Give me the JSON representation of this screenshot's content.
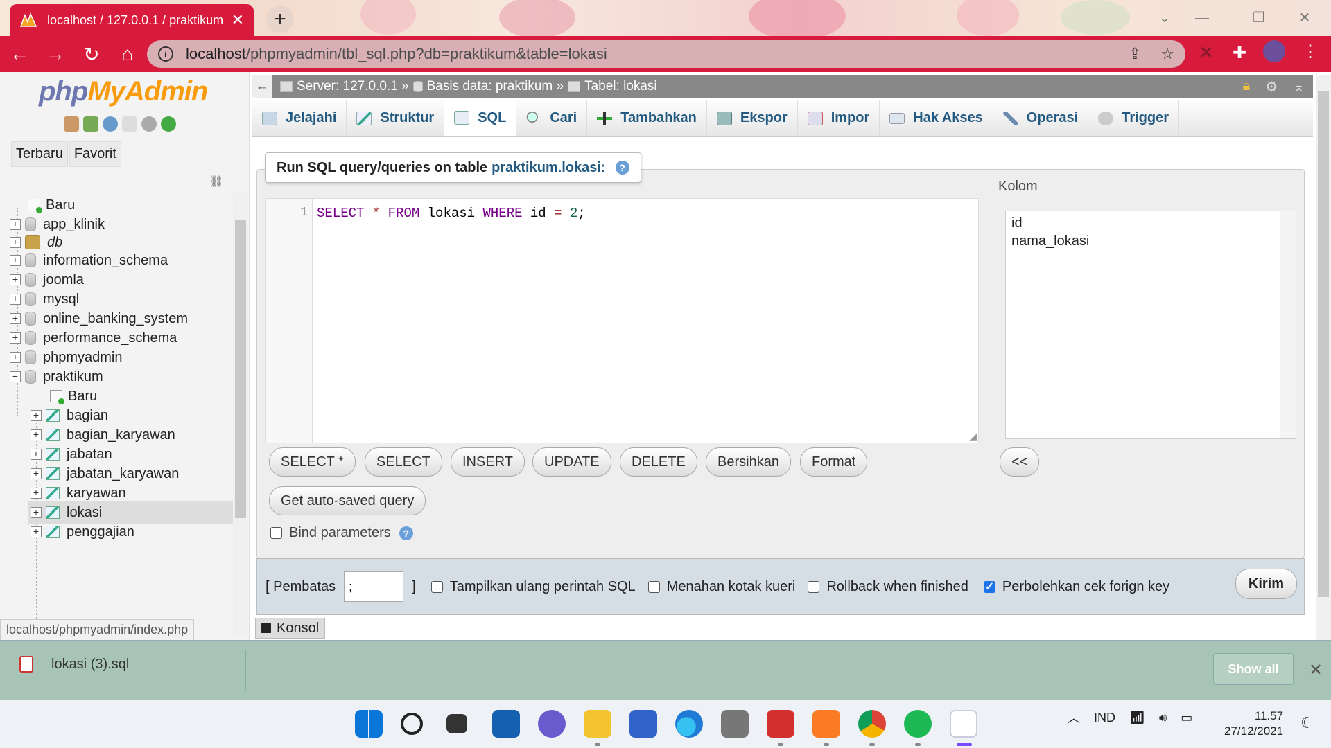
{
  "browser": {
    "tab_title": "localhost / 127.0.0.1 / praktikum",
    "url_host": "localhost",
    "url_path": "/phpmyadmin/tbl_sql.php?db=praktikum&table=lokasi",
    "status_link": "localhost/phpmyadmin/index.php"
  },
  "nav": {
    "logo_php": "php",
    "logo_myadmin": "MyAdmin",
    "tab_recent": "Terbaru",
    "tab_favorite": "Favorit",
    "tree": [
      {
        "label": "Baru"
      },
      {
        "label": "app_klinik"
      },
      {
        "label": "db"
      },
      {
        "label": "information_schema"
      },
      {
        "label": "joomla"
      },
      {
        "label": "mysql"
      },
      {
        "label": "online_banking_system"
      },
      {
        "label": "performance_schema"
      },
      {
        "label": "phpmyadmin"
      },
      {
        "label": "praktikum"
      },
      {
        "label": "Baru"
      },
      {
        "label": "bagian"
      },
      {
        "label": "bagian_karyawan"
      },
      {
        "label": "jabatan"
      },
      {
        "label": "jabatan_karyawan"
      },
      {
        "label": "karyawan"
      },
      {
        "label": "lokasi"
      },
      {
        "label": "penggajian"
      }
    ]
  },
  "breadcrumb": {
    "server": "Server: 127.0.0.1 »",
    "database": "Basis data: praktikum »",
    "table": "Tabel: lokasi"
  },
  "tabs": [
    "Jelajahi",
    "Struktur",
    "SQL",
    "Cari",
    "Tambahkan",
    "Ekspor",
    "Impor",
    "Hak Akses",
    "Operasi",
    "Trigger"
  ],
  "sql": {
    "legend_prefix": "Run SQL query/queries on table",
    "legend_table": "praktikum.lokasi:",
    "line_number": "1",
    "code": {
      "k1": "SELECT",
      "star": "*",
      "k2": "FROM",
      "table": "lokasi",
      "k3": "WHERE",
      "col": "id",
      "eq": "=",
      "val": "2",
      "semi": ";"
    },
    "buttons": [
      "SELECT *",
      "SELECT",
      "INSERT",
      "UPDATE",
      "DELETE",
      "Bersihkan",
      "Format"
    ],
    "autosaved": "Get auto-saved query",
    "bind_params": "Bind parameters",
    "kolom_label": "Kolom",
    "columns": [
      "id",
      "nama_lokasi"
    ],
    "insert_btn": "<<"
  },
  "footer": {
    "delimiter_label": "[ Pembatas",
    "delimiter_value": ";",
    "delimiter_close": "]",
    "opt_show_again": "Tampilkan ulang perintah SQL",
    "opt_retain": "Menahan kotak kueri",
    "opt_rollback": "Rollback when finished",
    "opt_fk": "Perbolehkan cek forign key",
    "submit": "Kirim"
  },
  "console": "Konsol",
  "downloads": {
    "file": "lokasi (3).sql",
    "show_all": "Show all"
  },
  "taskbar": {
    "lang": "IND",
    "time": "11.57",
    "date": "27/12/2021"
  },
  "colors": {
    "browser_accent": "#d81b3c",
    "pma_link": "#235a81",
    "download_bar": "#a8c4b6"
  }
}
